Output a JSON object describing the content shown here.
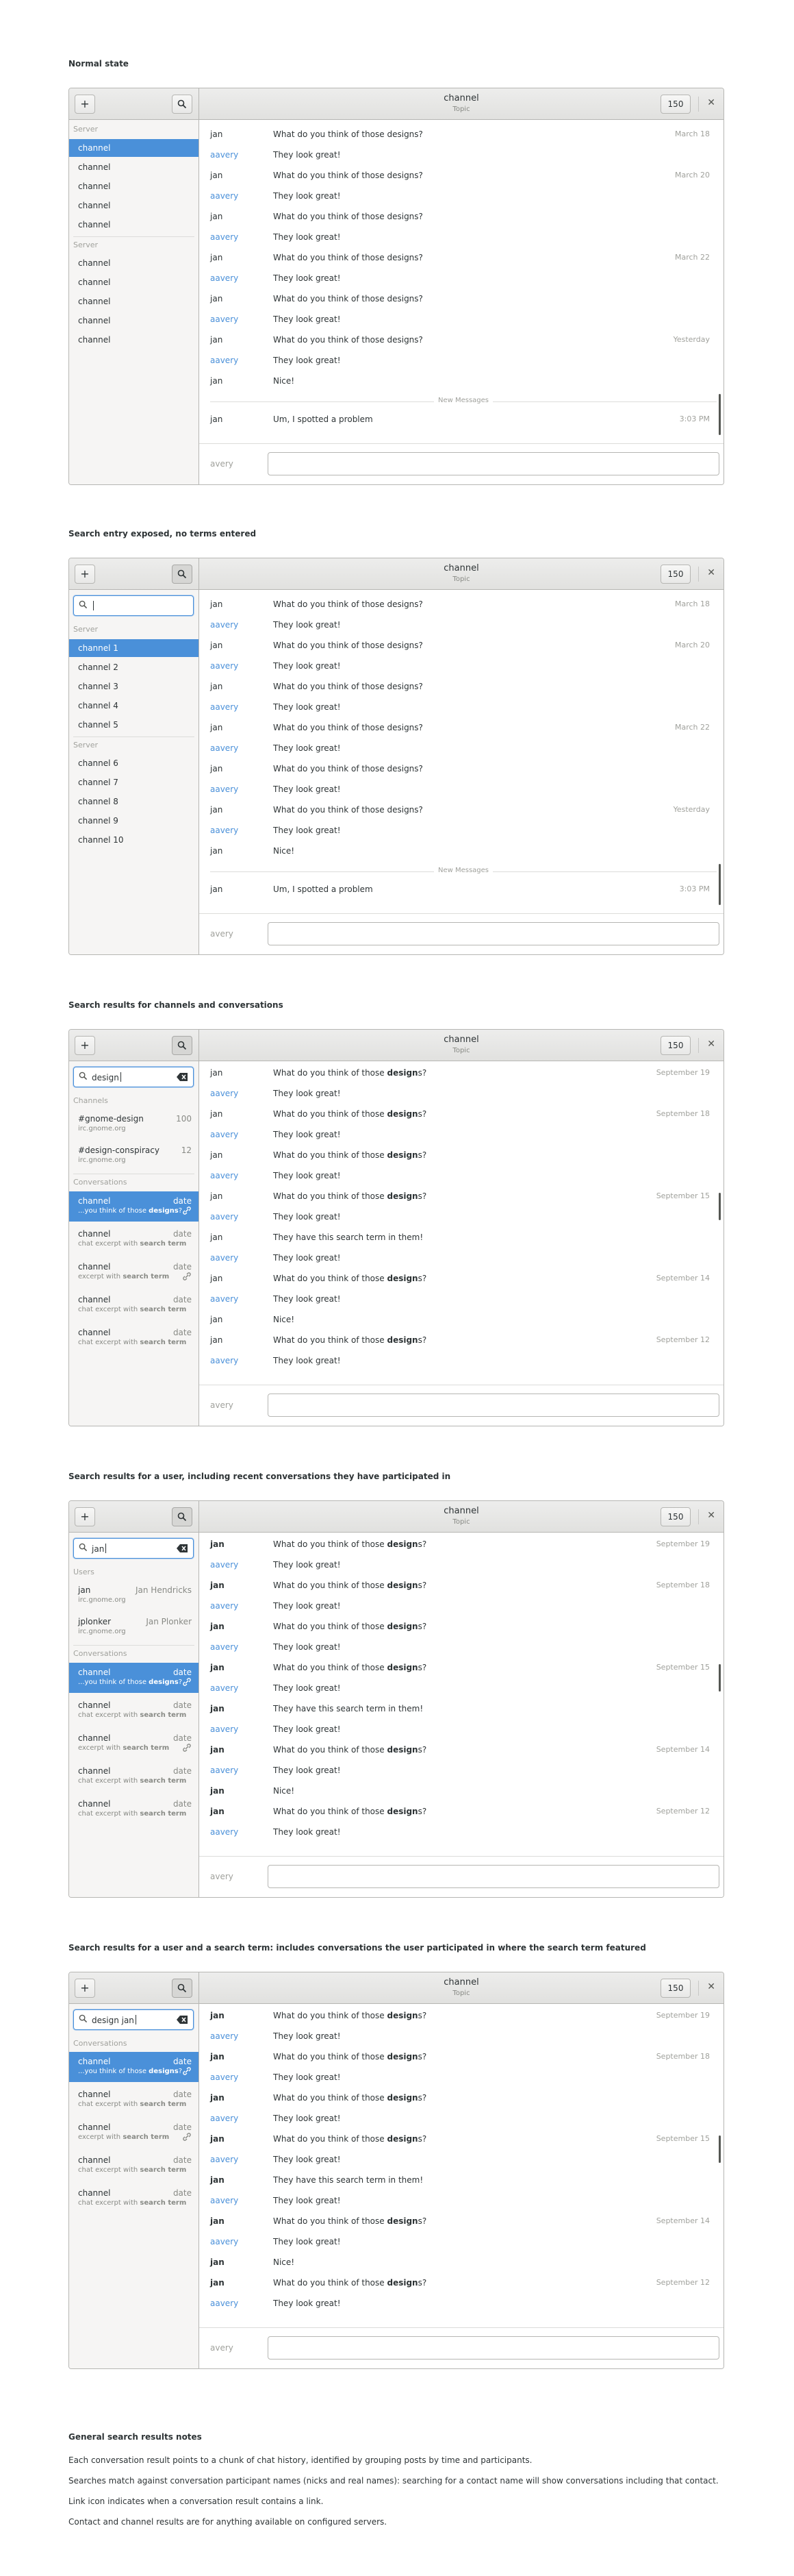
{
  "sections": [
    {
      "title": "Normal state",
      "channel": "channel",
      "topic": "Topic",
      "count": "150",
      "footer_nick": "avery"
    },
    {
      "title": "Search entry exposed, no terms entered",
      "channel": "channel",
      "topic": "Topic",
      "count": "150",
      "footer_nick": "avery",
      "search_value": ""
    },
    {
      "title": "Search results for channels and conversations",
      "channel": "channel",
      "topic": "Topic",
      "count": "150",
      "footer_nick": "avery",
      "search_value": "design"
    },
    {
      "title": "Search results for a user, including recent conversations they have participated in",
      "channel": "channel",
      "topic": "Topic",
      "count": "150",
      "footer_nick": "avery",
      "search_value": "jan"
    },
    {
      "title": "Search results for a user and a search term: includes conversations the user participated in where the search term featured",
      "channel": "channel",
      "topic": "Topic",
      "count": "150",
      "footer_nick": "avery",
      "search_value": "design jan"
    }
  ],
  "sidebar1": {
    "groups": [
      "Server",
      "Server"
    ],
    "items": [
      "channel",
      "channel",
      "channel",
      "channel",
      "channel",
      "channel",
      "channel",
      "channel",
      "channel",
      "channel"
    ]
  },
  "sidebar2": {
    "groups": [
      "Server",
      "Server"
    ],
    "items": [
      "channel 1",
      "channel 2",
      "channel 3",
      "channel 4",
      "channel 5",
      "channel 6",
      "channel 7",
      "channel 8",
      "channel 9",
      "channel 10"
    ]
  },
  "messages_a": [
    {
      "nick": "jan",
      "text": "What do you think of those designs?",
      "date": "March 18"
    },
    {
      "nick": "aavery",
      "text": "They look great!",
      "date": ""
    },
    {
      "nick": "jan",
      "text": "What do you think of those designs?",
      "date": "March 20"
    },
    {
      "nick": "aavery",
      "text": "They look great!",
      "date": ""
    },
    {
      "nick": "jan",
      "text": "What do you think of those designs?",
      "date": ""
    },
    {
      "nick": "aavery",
      "text": "They look great!",
      "date": ""
    },
    {
      "nick": "jan",
      "text": "What do you think of those designs?",
      "date": "March 22"
    },
    {
      "nick": "aavery",
      "text": "They look great!",
      "date": ""
    },
    {
      "nick": "jan",
      "text": "What do you think of those designs?",
      "date": ""
    },
    {
      "nick": "aavery",
      "text": "They look great!",
      "date": ""
    },
    {
      "nick": "jan",
      "text": "What do you think of those designs?",
      "date": "Yesterday"
    },
    {
      "nick": "aavery",
      "text": "They look great!",
      "date": ""
    },
    {
      "nick": "jan",
      "text": "Nice!",
      "date": ""
    }
  ],
  "new_messages_label": "New Messages",
  "late_message": {
    "nick": "jan",
    "text": "Um, I spotted a problem",
    "date": "3:03 PM"
  },
  "messages_b": [
    {
      "nick": "jan",
      "pre": "What do you think of those ",
      "bold": "design",
      "post": "s?",
      "date": "September 19"
    },
    {
      "nick": "aavery",
      "pre": "They look great!",
      "bold": "",
      "post": "",
      "date": ""
    },
    {
      "nick": "jan",
      "pre": "What do you think of those ",
      "bold": "design",
      "post": "s?",
      "date": "September 18"
    },
    {
      "nick": "aavery",
      "pre": "They look great!",
      "bold": "",
      "post": "",
      "date": ""
    },
    {
      "nick": "jan",
      "pre": "What do you think of those ",
      "bold": "design",
      "post": "s?",
      "date": ""
    },
    {
      "nick": "aavery",
      "pre": "They look great!",
      "bold": "",
      "post": "",
      "date": ""
    },
    {
      "nick": "jan",
      "pre": "What do you think of those ",
      "bold": "design",
      "post": "s?",
      "date": "September 15"
    },
    {
      "nick": "aavery",
      "pre": "They look great!",
      "bold": "",
      "post": "",
      "date": ""
    },
    {
      "nick": "jan",
      "pre": "They have this search term in them!",
      "bold": "",
      "post": "",
      "date": ""
    },
    {
      "nick": "aavery",
      "pre": "They look great!",
      "bold": "",
      "post": "",
      "date": ""
    },
    {
      "nick": "jan",
      "pre": "What do you think of those ",
      "bold": "design",
      "post": "s?",
      "date": "September 14"
    },
    {
      "nick": "aavery",
      "pre": "They look great!",
      "bold": "",
      "post": "",
      "date": ""
    },
    {
      "nick": "jan",
      "pre": "Nice!",
      "bold": "",
      "post": "",
      "date": ""
    },
    {
      "nick": "jan",
      "pre": "What do you think of those ",
      "bold": "design",
      "post": "s?",
      "date": "September 12"
    },
    {
      "nick": "aavery",
      "pre": "They look great!",
      "bold": "",
      "post": "",
      "date": ""
    }
  ],
  "search3": {
    "channels_label": "Channels",
    "channels": [
      {
        "name": "#gnome-design",
        "count": "100",
        "server": "irc.gnome.org"
      },
      {
        "name": "#design-conspiracy",
        "count": "12",
        "server": "irc.gnome.org"
      }
    ],
    "conversations_label": "Conversations"
  },
  "search4": {
    "users_label": "Users",
    "users": [
      {
        "nick": "jan",
        "name": "Jan Hendricks",
        "server": "irc.gnome.org"
      },
      {
        "nick": "jplonker",
        "name": "Jan Plonker",
        "server": "irc.gnome.org"
      }
    ],
    "conversations_label": "Conversations"
  },
  "search5": {
    "conversations_label": "Conversations"
  },
  "conversations": [
    {
      "title": "channel",
      "date": "date",
      "pre": "...you think of those ",
      "bold": "designs",
      "post": "?",
      "link": true
    },
    {
      "title": "channel",
      "date": "date",
      "pre": "chat excerpt with ",
      "bold": "search term",
      "post": "",
      "link": false
    },
    {
      "title": "channel",
      "date": "date",
      "pre": "excerpt with ",
      "bold": "search term",
      "post": "",
      "link": true
    },
    {
      "title": "channel",
      "date": "date",
      "pre": "chat excerpt with ",
      "bold": "search term",
      "post": "",
      "link": false
    },
    {
      "title": "channel",
      "date": "date",
      "pre": "chat excerpt with ",
      "bold": "search term",
      "post": "",
      "link": false
    }
  ],
  "notes": {
    "title": "General search results notes",
    "lines": [
      "Each conversation result points to a chunk of chat history, identified by grouping posts by time and participants.",
      "Searches match against conversation participant names (nicks and real names): searching for a contact name will show conversations including that contact.",
      "Link icon indicates when a conversation result contains a link.",
      "Contact and channel results are for anything available on configured servers."
    ]
  },
  "colors": {
    "accent": "#4a90d9",
    "text": "#2e3436",
    "dim": "#888a85"
  }
}
